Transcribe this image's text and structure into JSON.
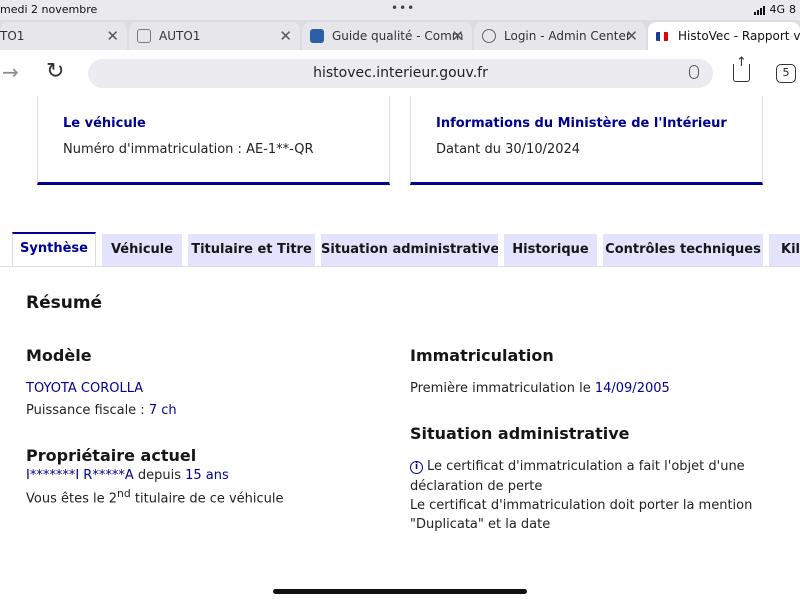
{
  "status_bar": {
    "date": "medi 2 novembre",
    "network": "4G",
    "battery": "8"
  },
  "browser": {
    "tabs": [
      {
        "title": "TO1",
        "active": false
      },
      {
        "title": "AUTO1",
        "active": false
      },
      {
        "title": "Guide qualité - Comm",
        "active": false
      },
      {
        "title": "Login - Admin Center",
        "active": false
      },
      {
        "title": "HistoVec - Rapport ve",
        "active": true
      }
    ],
    "url": "histovec.interieur.gouv.fr",
    "tab_count": "5"
  },
  "cards": [
    {
      "title": "Le véhicule",
      "value": "Numéro d'immatriculation : AE-1**-QR"
    },
    {
      "title": "Informations du Ministère de l'Intérieur",
      "value": "Datant du 30/10/2024"
    }
  ],
  "page_tabs": [
    {
      "label": "Synthèse",
      "active": true
    },
    {
      "label": "Véhicule"
    },
    {
      "label": "Titulaire et Titre"
    },
    {
      "label": "Situation administrative"
    },
    {
      "label": "Historique"
    },
    {
      "label": "Contrôles techniques"
    },
    {
      "label": "Kilo"
    }
  ],
  "summary": {
    "title": "Résumé",
    "model": {
      "heading": "Modèle",
      "name": "TOYOTA COROLLA",
      "power_label": "Puissance fiscale : ",
      "power_value": "7 ch"
    },
    "owner": {
      "heading": "Propriétaire actuel",
      "name": "I*******I R*****A",
      "since_label": " depuis ",
      "since_value": "15 ans",
      "rank_prefix": "Vous êtes le ",
      "rank_number": "2",
      "rank_suffix": "nd",
      "rank_rest": " titulaire de ce véhicule"
    },
    "registration": {
      "heading": "Immatriculation",
      "label": "Première immatriculation le ",
      "date": "14/09/2005"
    },
    "admin": {
      "heading": "Situation administrative",
      "line1": "Le certificat d'immatriculation a fait l'objet d'une",
      "line2": "déclaration de perte",
      "line3": "Le certificat d'immatriculation doit porter la mention",
      "line4": "\"Duplicata\" et la date"
    }
  },
  "colors": {
    "accent": "#000091",
    "tab_bg": "#e3e3fd"
  }
}
